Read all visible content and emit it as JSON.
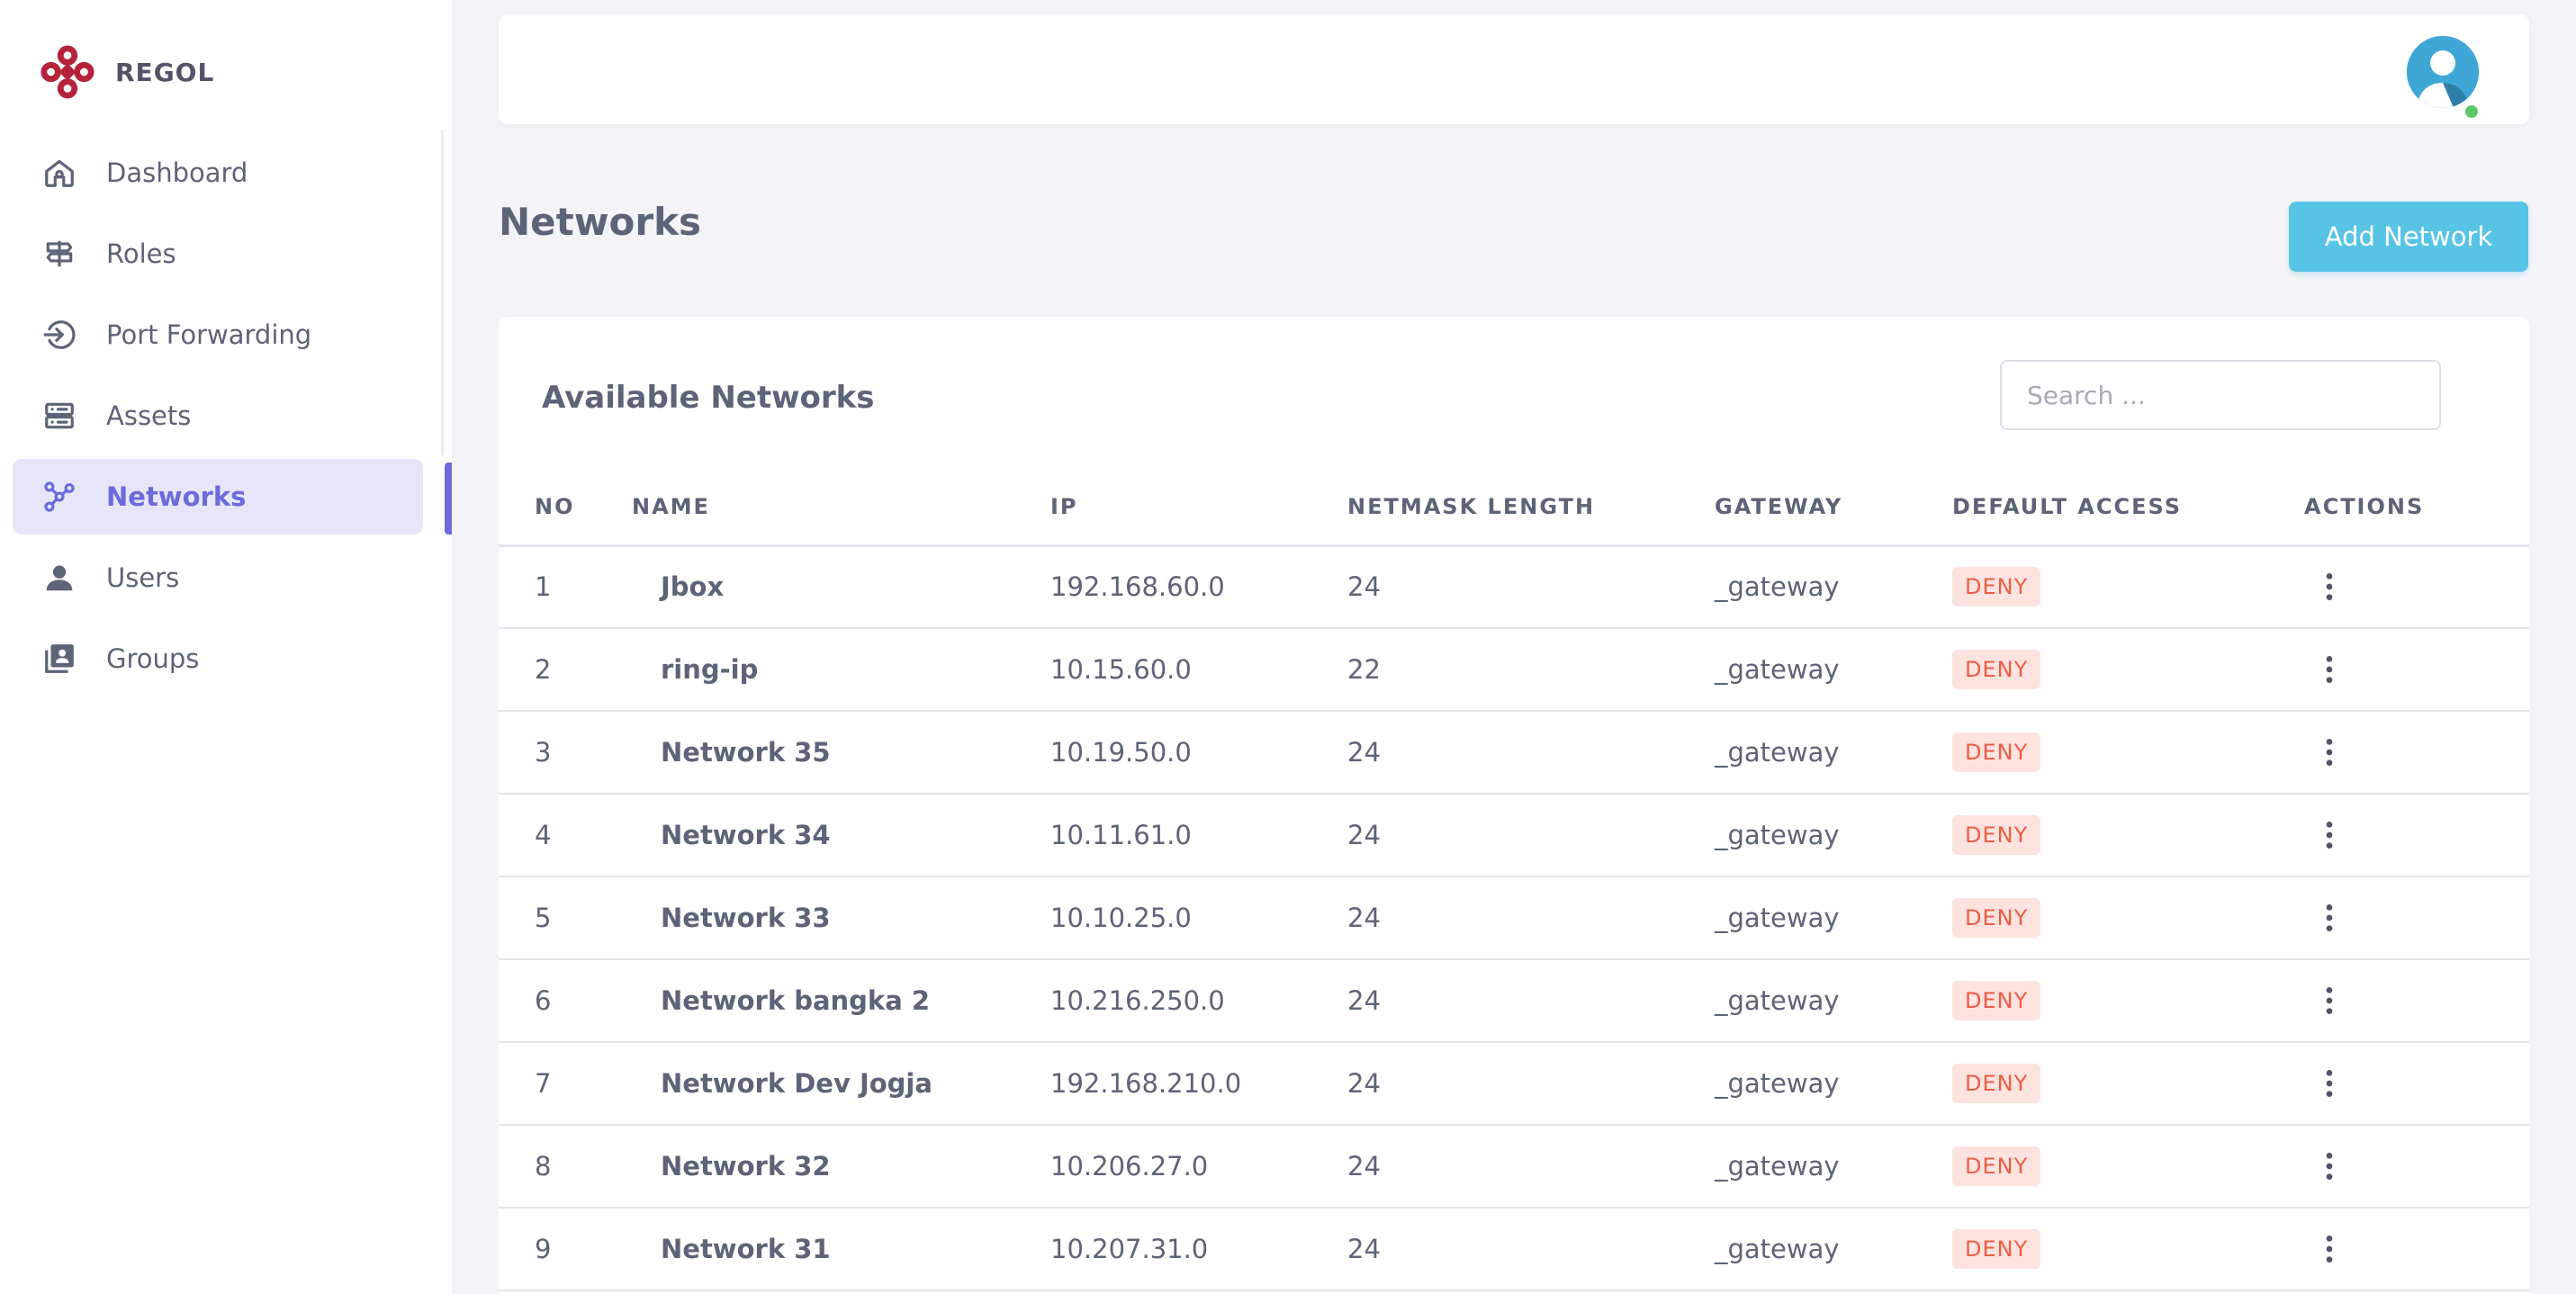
{
  "brand": {
    "name": "REGOL",
    "color": "#b5233a"
  },
  "sidebar": {
    "items": [
      {
        "label": "Dashboard",
        "icon": "home-icon",
        "active": false
      },
      {
        "label": "Roles",
        "icon": "signpost-icon",
        "active": false
      },
      {
        "label": "Port Forwarding",
        "icon": "login-arrow-icon",
        "active": false
      },
      {
        "label": "Assets",
        "icon": "server-icon",
        "active": false
      },
      {
        "label": "Networks",
        "icon": "network-nodes-icon",
        "active": true
      },
      {
        "label": "Users",
        "icon": "user-icon",
        "active": false
      },
      {
        "label": "Groups",
        "icon": "contacts-book-icon",
        "active": false
      }
    ]
  },
  "header": {
    "avatar_icon": "user-avatar-icon",
    "online": true
  },
  "page": {
    "title": "Networks",
    "add_button_label": "Add Network"
  },
  "card": {
    "title": "Available Networks",
    "search_placeholder": "Search ..."
  },
  "table": {
    "columns": [
      "NO",
      "NAME",
      "IP",
      "NETMASK LENGTH",
      "GATEWAY",
      "DEFAULT ACCESS",
      "ACTIONS"
    ],
    "rows": [
      {
        "no": "1",
        "name": "Jbox",
        "ip": "192.168.60.0",
        "netmask": "24",
        "gateway": "_gateway",
        "access": "DENY"
      },
      {
        "no": "2",
        "name": "ring-ip",
        "ip": "10.15.60.0",
        "netmask": "22",
        "gateway": "_gateway",
        "access": "DENY"
      },
      {
        "no": "3",
        "name": "Network 35",
        "ip": "10.19.50.0",
        "netmask": "24",
        "gateway": "_gateway",
        "access": "DENY"
      },
      {
        "no": "4",
        "name": "Network 34",
        "ip": "10.11.61.0",
        "netmask": "24",
        "gateway": "_gateway",
        "access": "DENY"
      },
      {
        "no": "5",
        "name": "Network 33",
        "ip": "10.10.25.0",
        "netmask": "24",
        "gateway": "_gateway",
        "access": "DENY"
      },
      {
        "no": "6",
        "name": "Network bangka 2",
        "ip": "10.216.250.0",
        "netmask": "24",
        "gateway": "_gateway",
        "access": "DENY"
      },
      {
        "no": "7",
        "name": "Network Dev Jogja",
        "ip": "192.168.210.0",
        "netmask": "24",
        "gateway": "_gateway",
        "access": "DENY"
      },
      {
        "no": "8",
        "name": "Network 32",
        "ip": "10.206.27.0",
        "netmask": "24",
        "gateway": "_gateway",
        "access": "DENY"
      },
      {
        "no": "9",
        "name": "Network 31",
        "ip": "10.207.31.0",
        "netmask": "24",
        "gateway": "_gateway",
        "access": "DENY"
      }
    ]
  },
  "colors": {
    "accent": "#6b6bdb",
    "accent_bg": "#e6e6fb",
    "button": "#57c4e6",
    "deny_text": "#ee5c46",
    "deny_bg": "#fde3df",
    "online": "#5fc76a"
  }
}
